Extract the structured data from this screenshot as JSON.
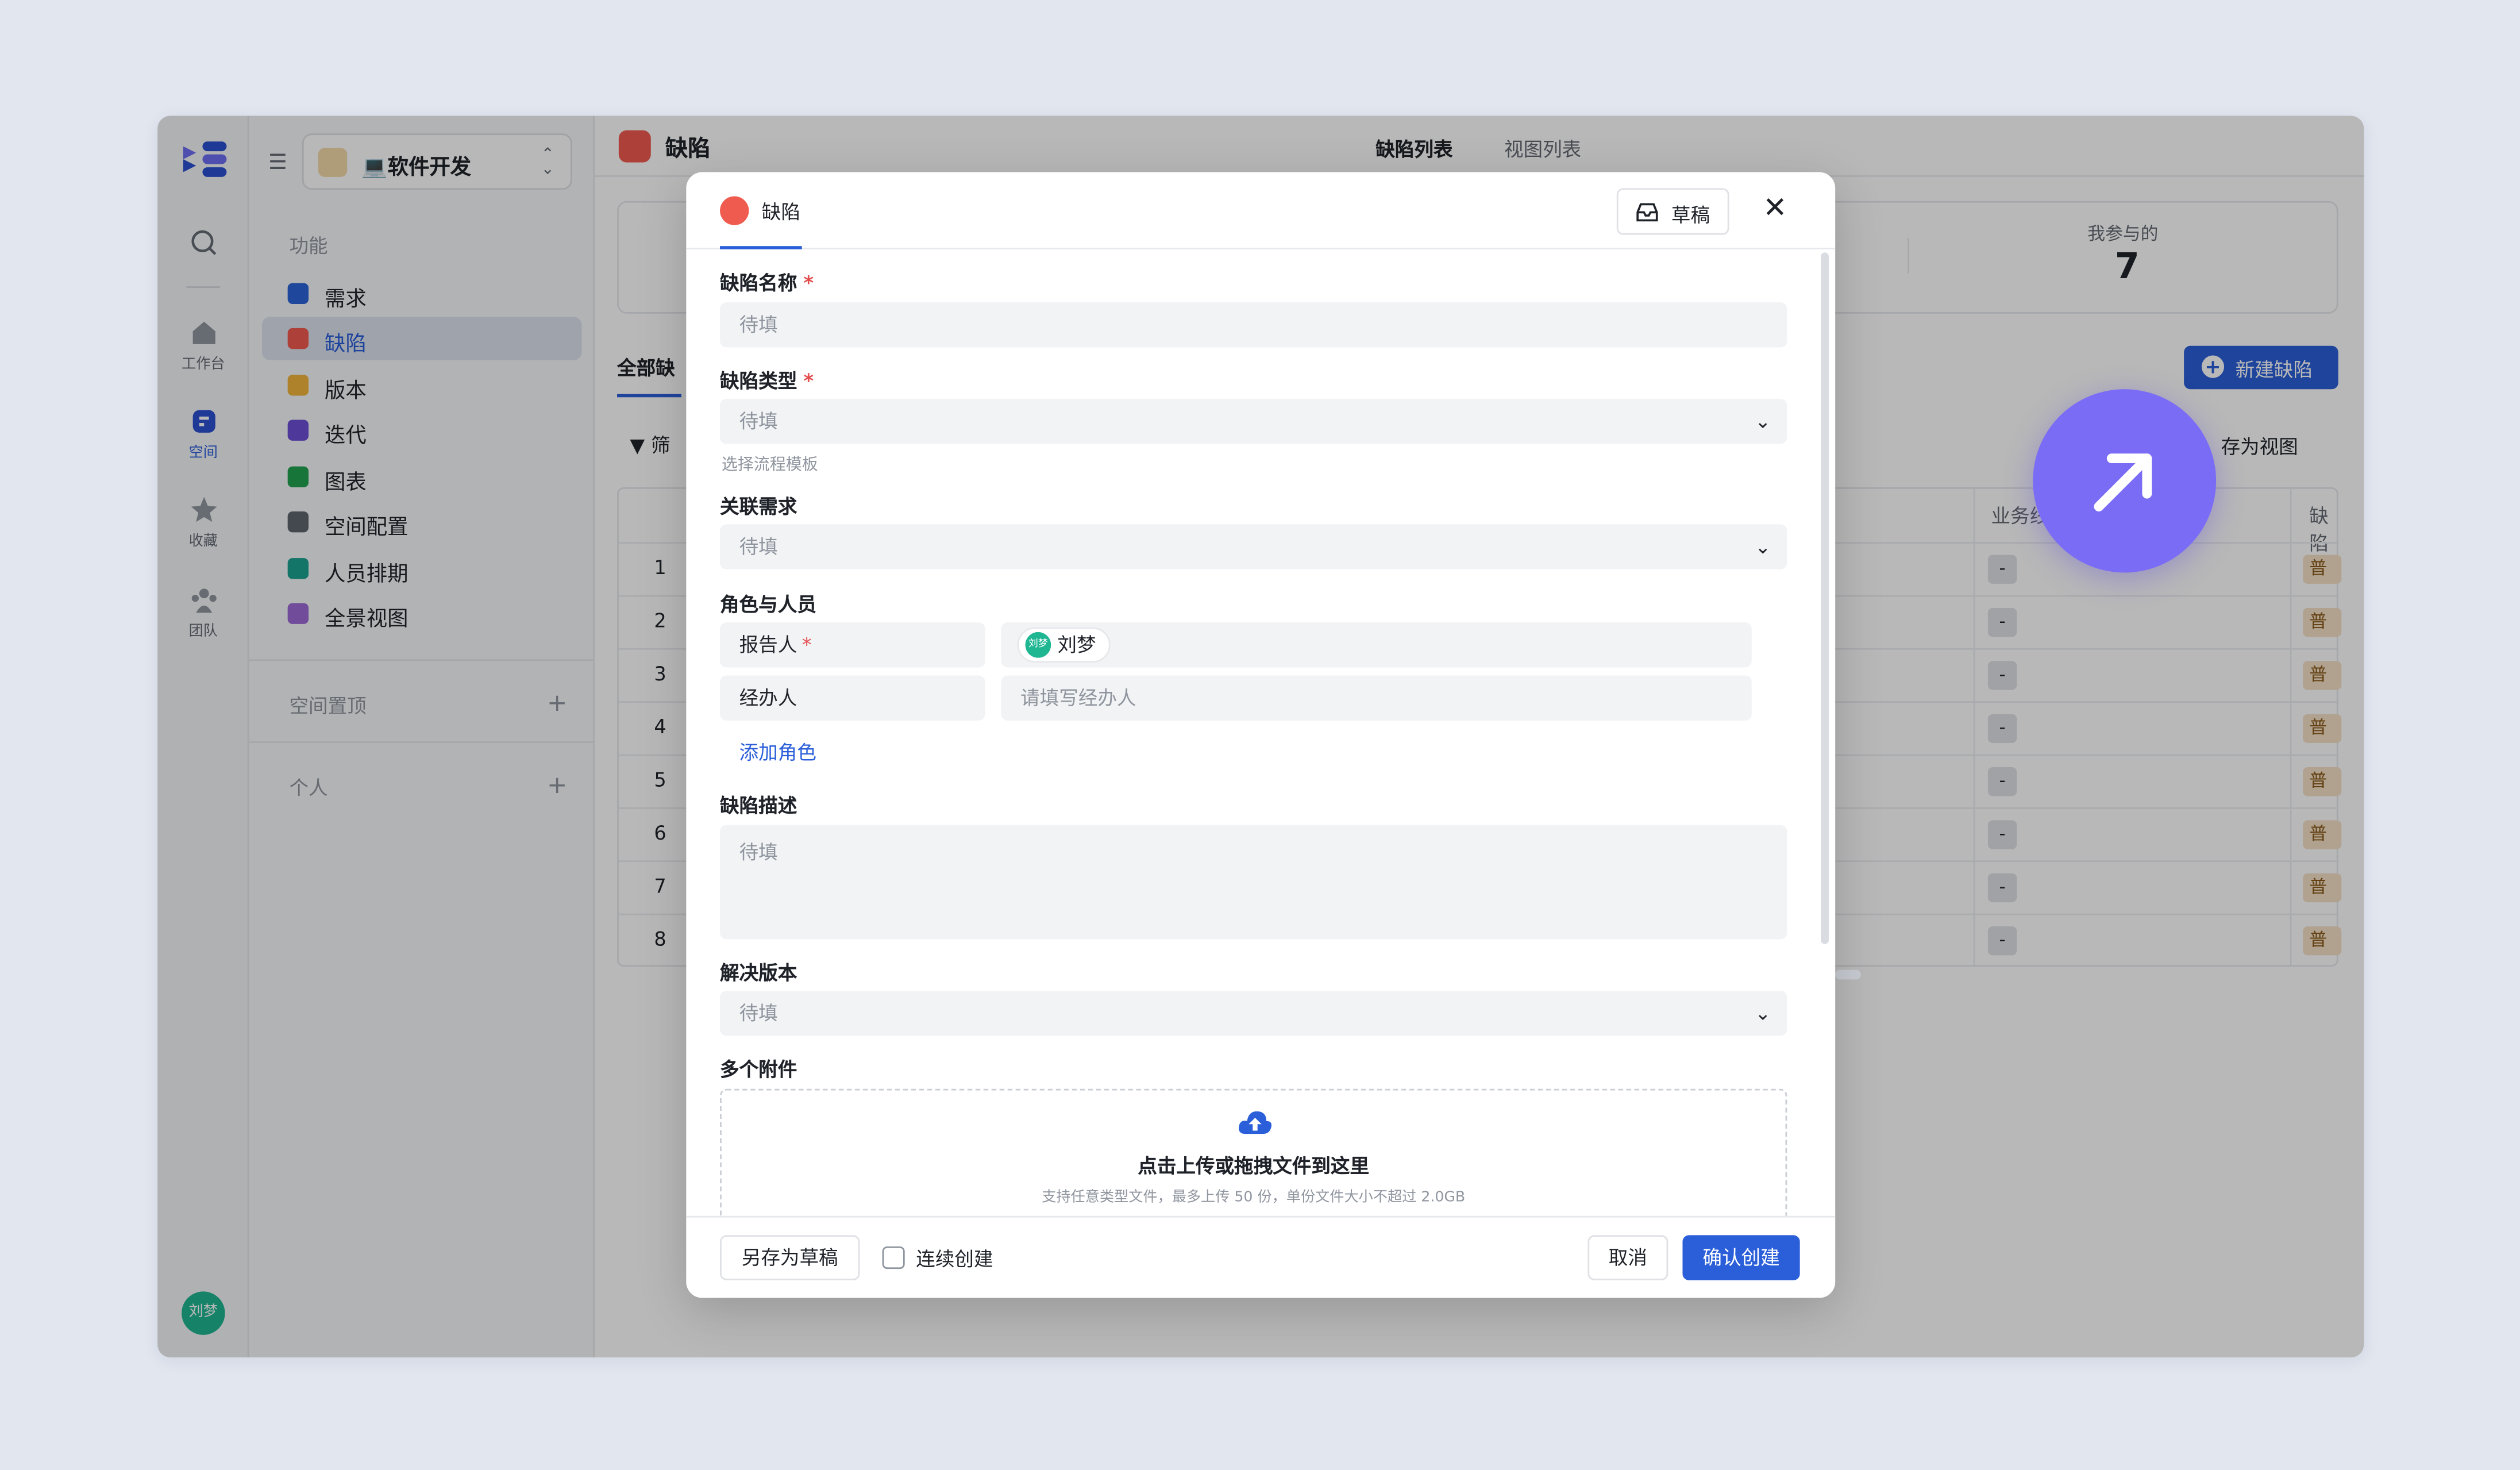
{
  "rail": {
    "items": [
      {
        "label": ""
      },
      {
        "label": "工作台"
      },
      {
        "label": "空间"
      },
      {
        "label": "收藏"
      },
      {
        "label": "团队"
      }
    ],
    "avatar": "刘梦"
  },
  "sidebar": {
    "space_name": "💻软件开发",
    "group_features": "功能",
    "items": [
      {
        "label": "需求",
        "color": "#2b63d9"
      },
      {
        "label": "缺陷",
        "color": "#f05b4f"
      },
      {
        "label": "版本",
        "color": "#f0b43c"
      },
      {
        "label": "迭代",
        "color": "#6c4fd6"
      },
      {
        "label": "图表",
        "color": "#22a34f"
      },
      {
        "label": "空间配置",
        "color": "#5f6670"
      },
      {
        "label": "人员排期",
        "color": "#19a391"
      },
      {
        "label": "全景视图",
        "color": "#9b6ad6"
      }
    ],
    "group_pinned": "空间置顶",
    "group_personal": "个人"
  },
  "main": {
    "title": "缺陷",
    "tabs": [
      "缺陷列表",
      "视图列表"
    ],
    "stat_label": "我参与的",
    "stat_value": "7",
    "all_tab": "全部缺",
    "filter": "筛",
    "new_button": "新建缺陷",
    "save_view": "存为视图",
    "col_business": "业务线",
    "col_defect": "缺陷",
    "rows": [
      "1",
      "2",
      "3",
      "4",
      "5",
      "6",
      "7",
      "8"
    ],
    "cell_dash": "-",
    "cell_priority": "普通"
  },
  "modal": {
    "title": "缺陷",
    "draft_button": "草稿",
    "fields": {
      "name_label": "缺陷名称",
      "name_placeholder": "待填",
      "type_label": "缺陷类型",
      "type_placeholder": "待填",
      "type_hint": "选择流程模板",
      "req_label": "关联需求",
      "req_placeholder": "待填",
      "roles_label": "角色与人员",
      "reporter_label": "报告人",
      "reporter_value": "刘梦",
      "reporter_avatar": "刘梦",
      "handler_label": "经办人",
      "handler_placeholder": "请填写经办人",
      "add_role": "添加角色",
      "desc_label": "缺陷描述",
      "desc_placeholder": "待填",
      "version_label": "解决版本",
      "version_placeholder": "待填",
      "attach_label": "多个附件",
      "upload_title": "点击上传或拖拽文件到这里",
      "upload_hint": "支持任意类型文件，最多上传 50 份，单份文件大小不超过 2.0GB"
    },
    "footer": {
      "save_draft": "另存为草稿",
      "continuous": "连续创建",
      "cancel": "取消",
      "confirm": "确认创建"
    }
  },
  "colors": {
    "accent": "#2b5fd9",
    "danger": "#f05b4f",
    "fab": "#7b6cf6"
  }
}
